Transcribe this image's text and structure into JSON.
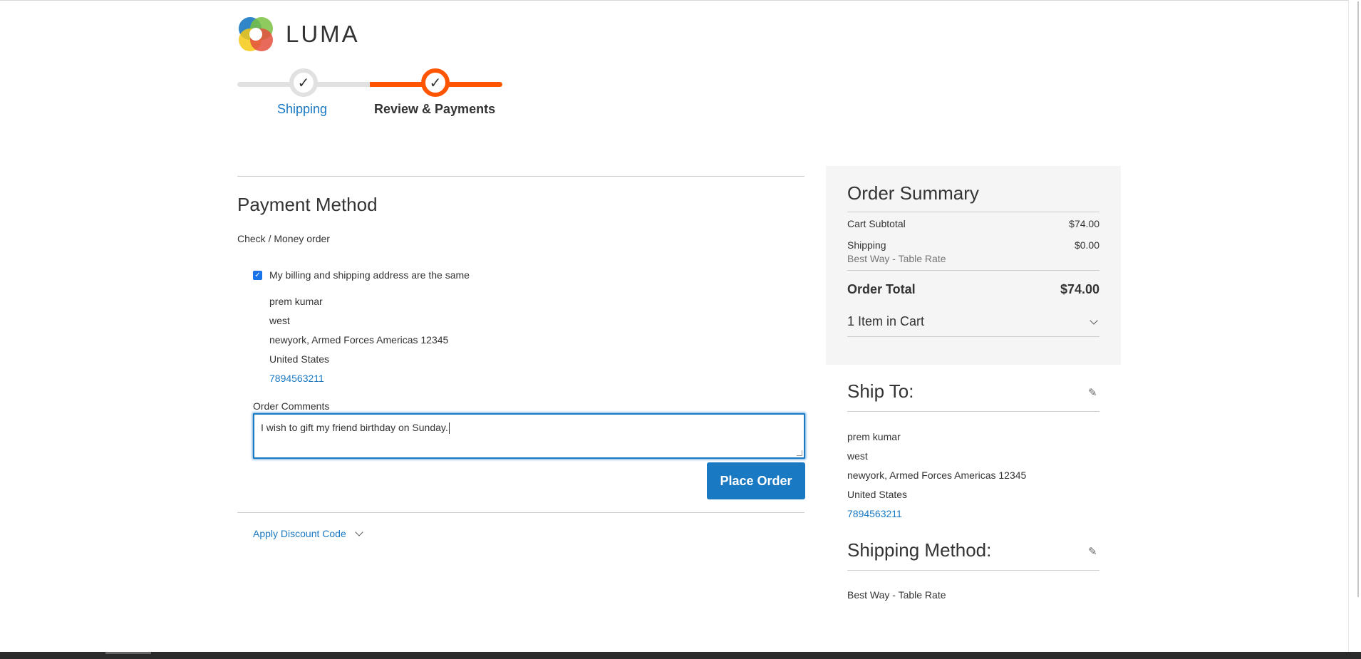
{
  "brand": {
    "name": "LUMA"
  },
  "progress": {
    "steps": [
      {
        "label": "Shipping",
        "state": "done"
      },
      {
        "label": "Review & Payments",
        "state": "active"
      }
    ]
  },
  "payment": {
    "title": "Payment Method",
    "method": "Check / Money order",
    "same_address_label": "My billing and shipping address are the same",
    "same_address_checked": true,
    "billing_address": {
      "name": "prem kumar",
      "street": "west",
      "city_region_zip": "newyork, Armed Forces Americas 12345",
      "country": "United States",
      "phone": "7894563211"
    },
    "comments_label": "Order Comments",
    "comments_value": "I wish to gift my friend birthday on Sunday.",
    "place_order_label": "Place Order",
    "discount_label": "Apply Discount Code"
  },
  "summary": {
    "title": "Order Summary",
    "subtotal_label": "Cart Subtotal",
    "subtotal_value": "$74.00",
    "shipping_label": "Shipping",
    "shipping_value": "$0.00",
    "shipping_method": "Best Way - Table Rate",
    "total_label": "Order Total",
    "total_value": "$74.00",
    "items_label": "1 Item in Cart"
  },
  "ship_to": {
    "title": "Ship To:",
    "name": "prem kumar",
    "street": "west",
    "city_region_zip": "newyork, Armed Forces Americas 12345",
    "country": "United States",
    "phone": "7894563211"
  },
  "shipping_method": {
    "title": "Shipping Method:",
    "value": "Best Way - Table Rate"
  },
  "colors": {
    "accent_blue": "#1979c3",
    "progress_orange": "#ff5501"
  }
}
